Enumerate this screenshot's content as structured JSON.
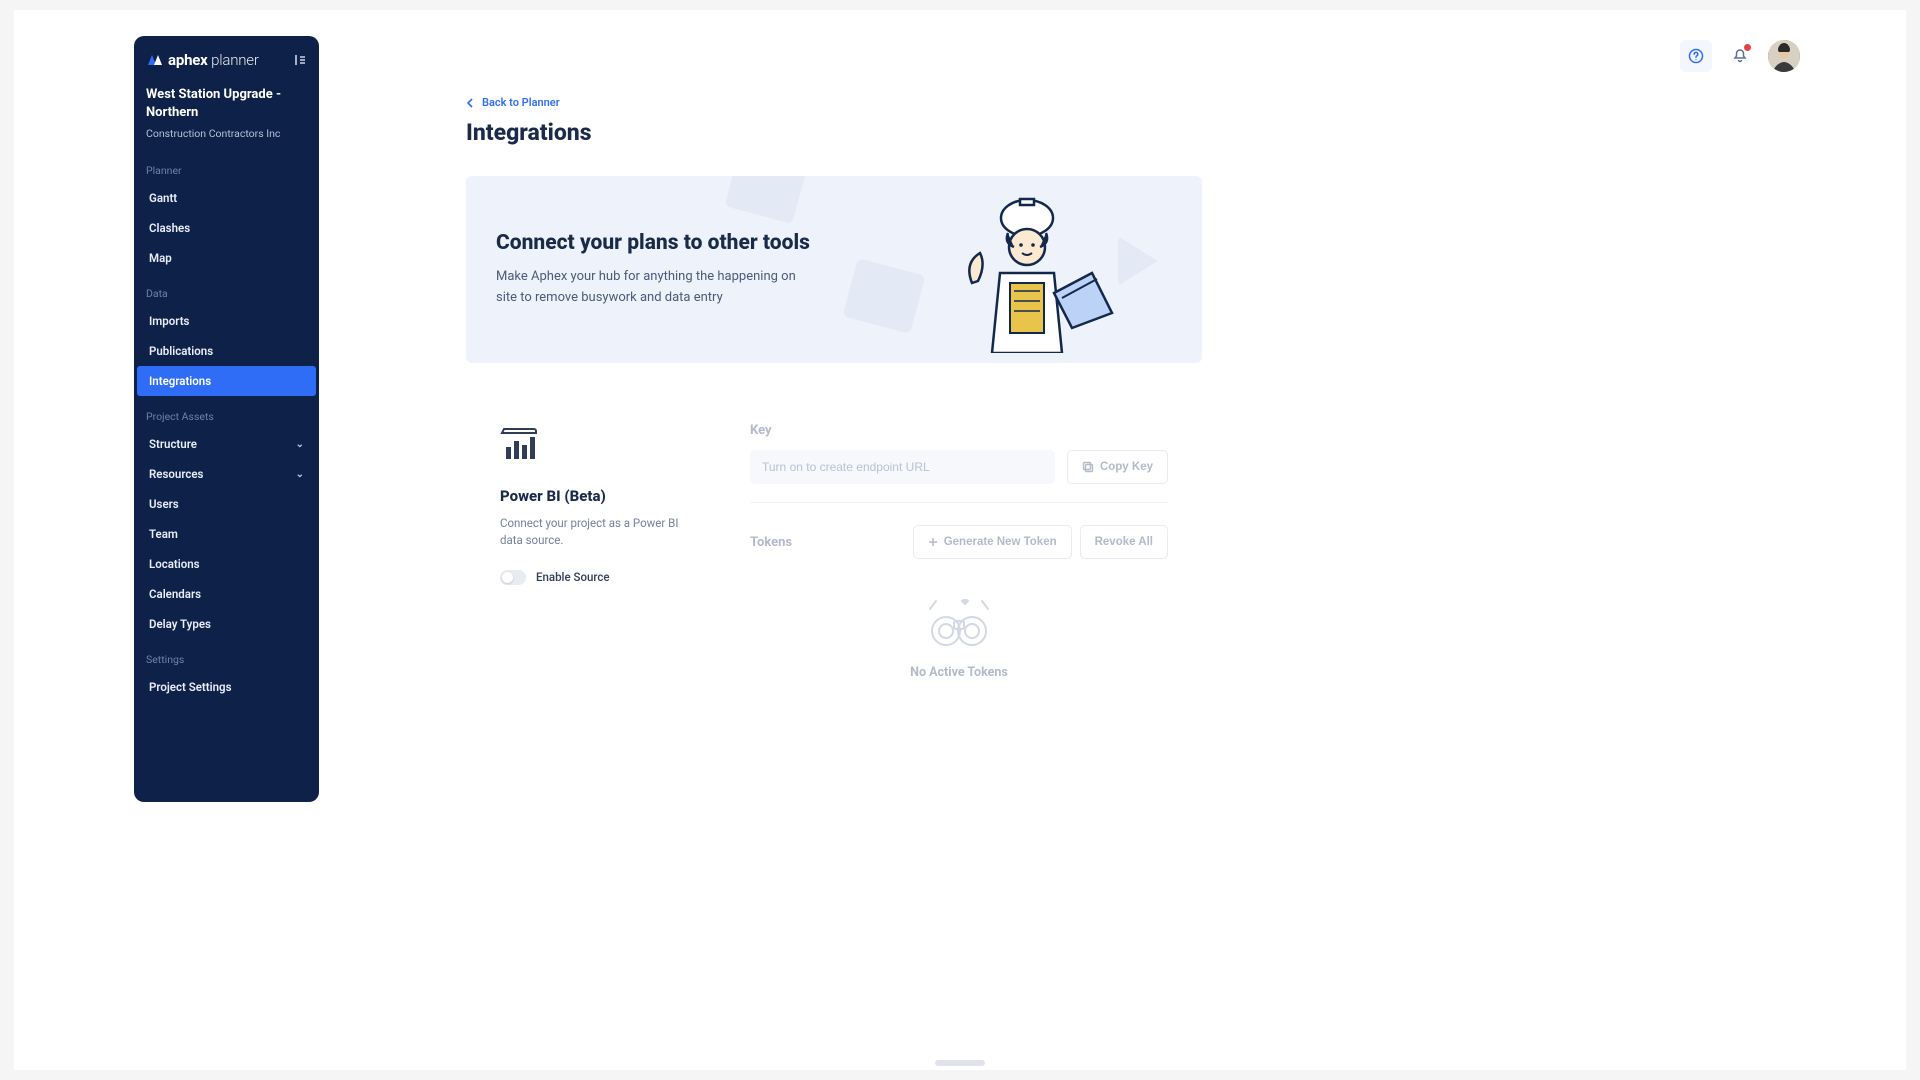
{
  "app": {
    "brand_bold": "aphex",
    "brand_thin": "planner"
  },
  "sidebar": {
    "project_title": "West Station Upgrade - Northern",
    "project_sub": "Construction Contractors Inc",
    "sections": {
      "planner_label": "Planner",
      "data_label": "Data",
      "assets_label": "Project Assets",
      "settings_label": "Settings"
    },
    "items": {
      "gantt": "Gantt",
      "clashes": "Clashes",
      "map": "Map",
      "imports": "Imports",
      "publications": "Publications",
      "integrations": "Integrations",
      "structure": "Structure",
      "resources": "Resources",
      "users": "Users",
      "team": "Team",
      "locations": "Locations",
      "calendars": "Calendars",
      "delay_types": "Delay Types",
      "project_settings": "Project Settings"
    }
  },
  "header": {
    "back_label": "Back to Planner"
  },
  "page": {
    "title": "Integrations",
    "hero_title": "Connect your plans to other tools",
    "hero_body": "Make Aphex your hub for anything the happening on site to remove busywork and data entry"
  },
  "integration": {
    "name": "Power BI (Beta)",
    "desc": "Connect your project as a Power BI data source.",
    "toggle_label": "Enable Source",
    "key_label": "Key",
    "key_placeholder": "Turn on to create endpoint URL",
    "copy_key": "Copy Key",
    "tokens_label": "Tokens",
    "generate_token": "Generate New Token",
    "revoke_all": "Revoke All",
    "empty": "No Active Tokens"
  }
}
